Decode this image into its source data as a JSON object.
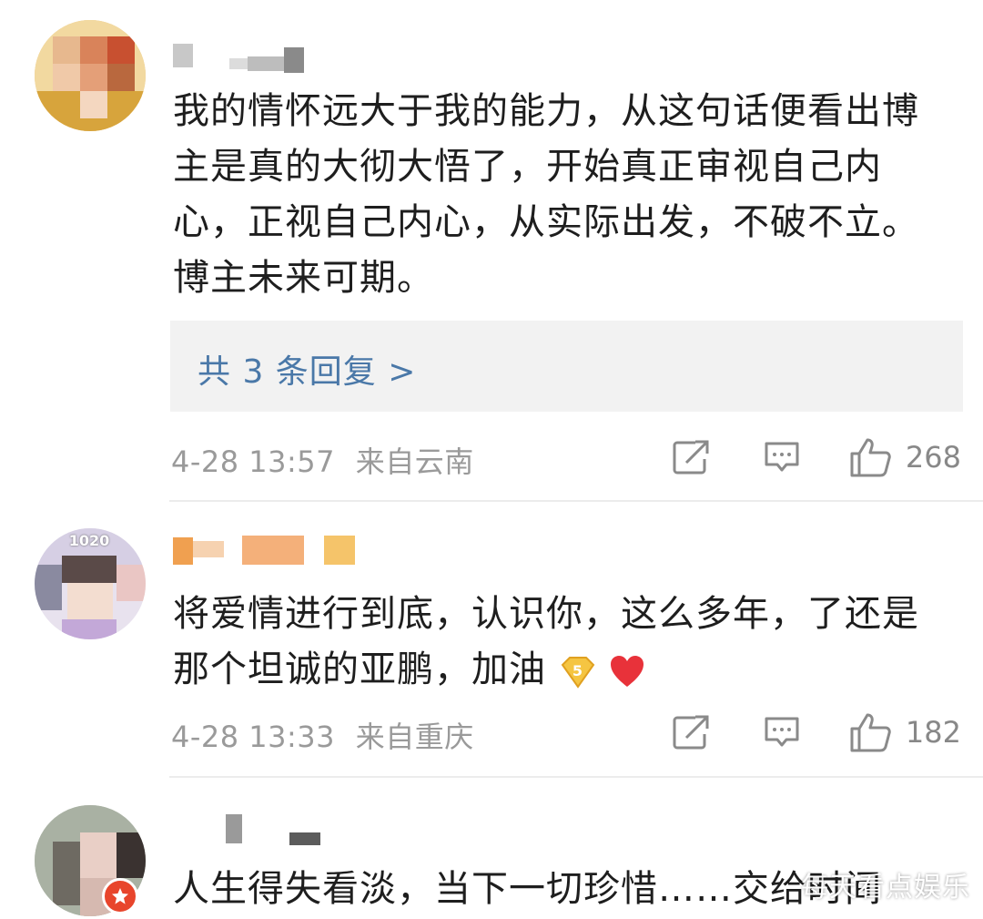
{
  "comments": [
    {
      "text": "我的情怀远大于我的能力，从这句话便看出博主是真的大彻大悟了，开始真正审视自己内心，正视自己内心，从实际出发，不破不立。博主未来可期。",
      "replies_label": "共 3 条回复 >",
      "timestamp": "4-28 13:57",
      "location": "来自云南",
      "likes": "268"
    },
    {
      "text": "将爱情进行到底，认识你，这么多年，了还是那个坦诚的亚鹏，加油",
      "timestamp": "4-28 13:33",
      "location": "来自重庆",
      "likes": "182",
      "avatar_badge": "1020"
    },
    {
      "text": "人生得失看淡，当下一切珍惜……交给时间"
    }
  ],
  "icons": {
    "share": "share-icon",
    "comment": "comment-icon",
    "like": "thumbs-up-icon",
    "heart": "heart-icon",
    "verified": "verified-badge-icon"
  },
  "colors": {
    "reply_link": "#4a78a8",
    "meta_text": "#9a9a9a",
    "reply_box": "#f2f2f2",
    "username_orange": "#f0a050",
    "badge_red": "#e8452c"
  },
  "watermark": "每天看点娱乐"
}
